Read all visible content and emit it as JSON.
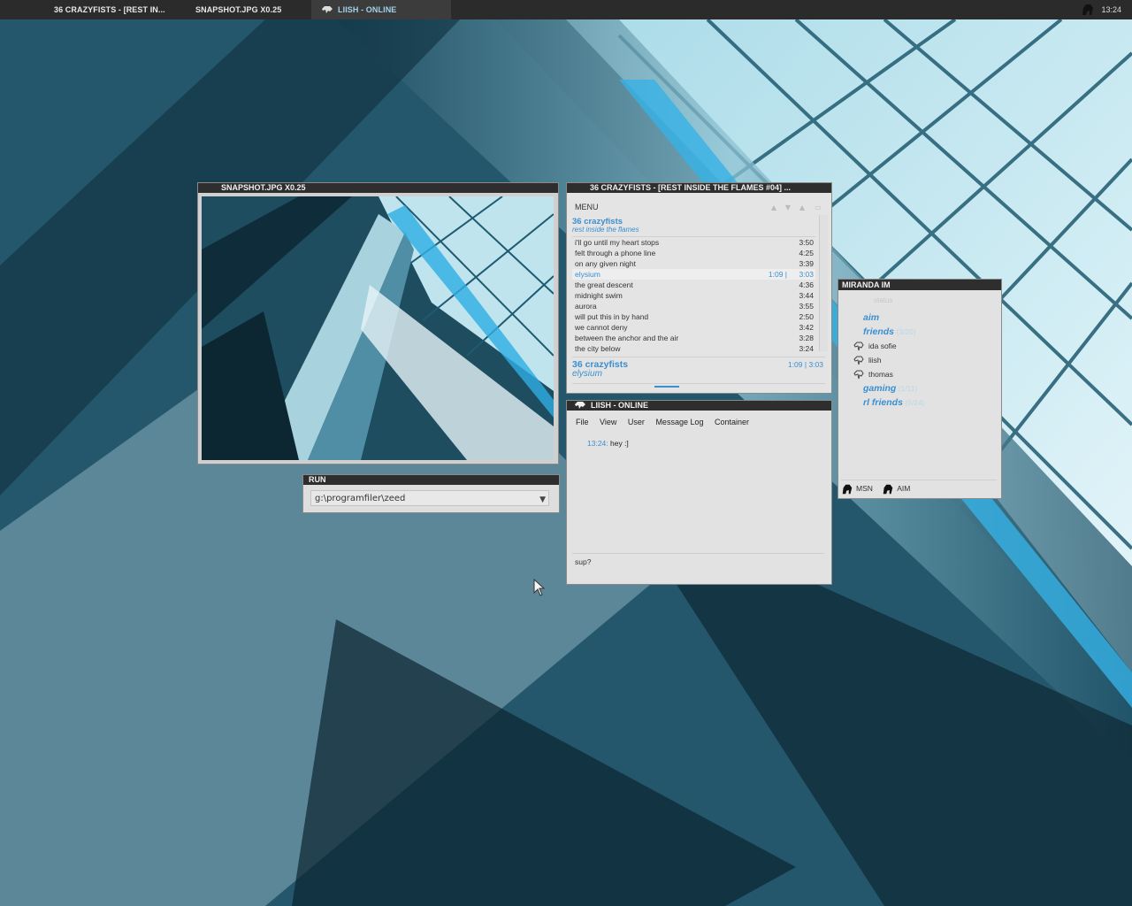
{
  "taskbar": {
    "tasks": [
      {
        "label": "36 CRAZYFISTS - [REST IN..."
      },
      {
        "label": "SNAPSHOT.JPG X0.25"
      },
      {
        "label": "LIISH - ONLINE"
      }
    ],
    "clock": "13:24"
  },
  "snapshot": {
    "title": "SNAPSHOT.JPG X0.25"
  },
  "run": {
    "title": "RUN",
    "value": "g:\\programfiler\\zeed"
  },
  "player": {
    "title": "36 CRAZYFISTS - [REST INSIDE THE FLAMES #04] ...",
    "menu": "MENU",
    "artist": "36 crazyfists",
    "album": "rest inside the flames",
    "tracks": [
      {
        "title": "i'll go until my heart stops",
        "duration": "3:50"
      },
      {
        "title": "felt through a phone line",
        "duration": "4:25"
      },
      {
        "title": "on any given night",
        "duration": "3:39"
      },
      {
        "title": "elysium",
        "duration": "3:03",
        "position": "1:09  |"
      },
      {
        "title": "the great descent",
        "duration": "4:36"
      },
      {
        "title": "midnight swim",
        "duration": "3:44"
      },
      {
        "title": "aurora",
        "duration": "3:55"
      },
      {
        "title": "will put this in by hand",
        "duration": "2:50"
      },
      {
        "title": "we cannot deny",
        "duration": "3:42"
      },
      {
        "title": "between the anchor and the air",
        "duration": "3:28"
      },
      {
        "title": "the city below",
        "duration": "3:24"
      }
    ],
    "now_artist": "36 crazyfists",
    "now_title": "elysium",
    "now_time": "1:09 | 3:03",
    "progress": 0.38
  },
  "chat": {
    "title": "LIISH - ONLINE",
    "menu": [
      "File",
      "View",
      "User",
      "Message Log",
      "Container"
    ],
    "log_time": "13:24:",
    "log_text": " hey :]",
    "input": "sup?"
  },
  "miranda": {
    "title": "MIRANDA IM",
    "status": "status",
    "groups": [
      {
        "name": "aim",
        "count": ""
      },
      {
        "name": "friends",
        "count": " (3/20)"
      },
      {
        "name": "gaming",
        "count": " (1/11)"
      },
      {
        "name": "rl friends",
        "count": " (6/24)"
      }
    ],
    "contacts": [
      "ida sofie",
      "liish",
      "thomas"
    ],
    "protocols": [
      "MSN",
      "AIM"
    ]
  },
  "colors": {
    "accent": "#3a8fd0",
    "titlebar": "#2e2e2e",
    "window": "#e2e2e2"
  }
}
